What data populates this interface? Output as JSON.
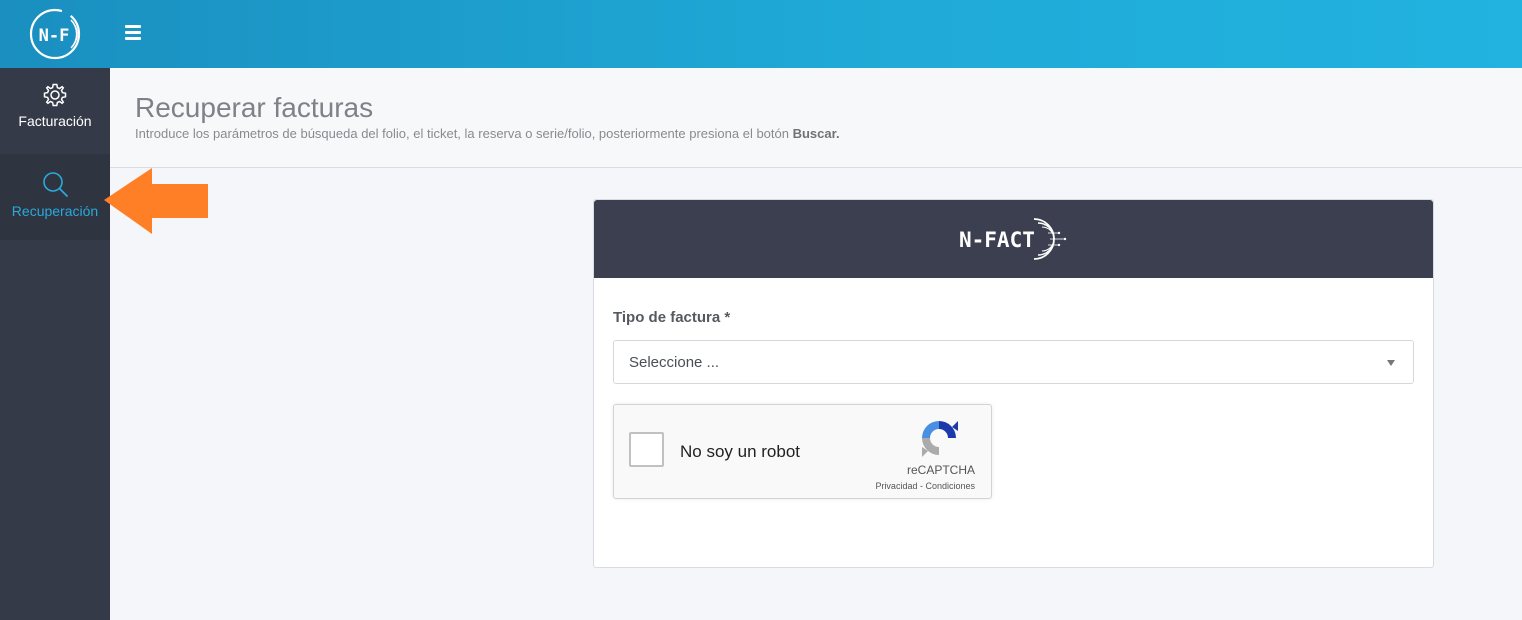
{
  "topbar": {
    "logo_text": "N-F",
    "menu_icon": "hamburger-icon"
  },
  "sidebar": {
    "items": [
      {
        "label": "Facturación",
        "icon": "gear-icon",
        "active": false
      },
      {
        "label": "Recuperación",
        "icon": "search-icon",
        "active": true
      }
    ]
  },
  "header": {
    "title": "Recuperar facturas",
    "subtitle": "Introduce los parámetros de búsqueda del folio, el ticket, la reserva o serie/folio, posteriormente presiona el botón ",
    "subtitle_strong": "Buscar."
  },
  "card": {
    "logo_text": "N-FACT",
    "field_label": "Tipo de factura *",
    "select_value": "Seleccione ..."
  },
  "captcha": {
    "label": "No soy un robot",
    "brand": "reCAPTCHA",
    "privacy": "Privacidad",
    "separator": " - ",
    "terms": "Condiciones"
  },
  "colors": {
    "topbar": "#1fa9d6",
    "sidebar": "#353a48",
    "active_item": "#2ba9db",
    "card_header": "#3b3f50",
    "arrow": "#ff7f27"
  }
}
